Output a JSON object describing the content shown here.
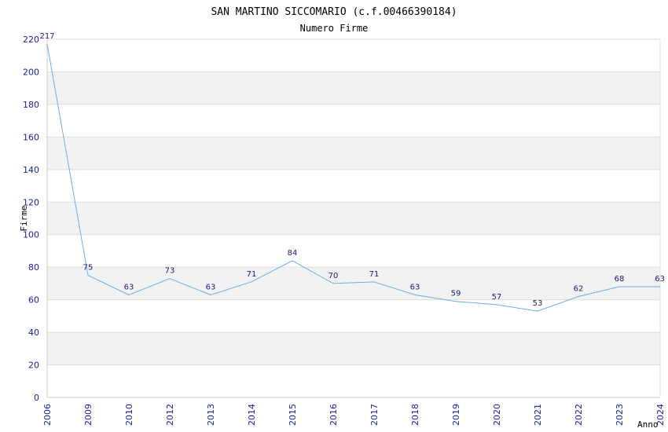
{
  "chart_data": {
    "type": "line",
    "title": "SAN MARTINO SICCOMARIO (c.f.00466390184)",
    "subtitle": "Numero Firme",
    "xlabel": "Anno",
    "ylabel": "Firme",
    "categories": [
      "2006",
      "2009",
      "2010",
      "2012",
      "2013",
      "2014",
      "2015",
      "2016",
      "2017",
      "2018",
      "2019",
      "2020",
      "2021",
      "2022",
      "2023",
      "2024"
    ],
    "values": [
      217,
      75,
      63,
      73,
      63,
      71,
      84,
      70,
      71,
      63,
      59,
      57,
      53,
      62,
      68,
      68
    ],
    "data_labels": [
      "217",
      "75",
      "63",
      "73",
      "63",
      "71",
      "84",
      "70",
      "71",
      "63",
      "59",
      "57",
      "53",
      "62",
      "68",
      "63"
    ],
    "ylim": [
      0,
      220
    ],
    "yticks": [
      0,
      20,
      40,
      60,
      80,
      100,
      120,
      140,
      160,
      180,
      200,
      220
    ],
    "grid": true,
    "colors": {
      "line": "#6aaee8",
      "band_alt": "#f2f2f2",
      "band": "#ffffff",
      "gridline": "#dddddd",
      "tick_text": "#1a1aa6",
      "label_text": "#1a1a80"
    }
  }
}
